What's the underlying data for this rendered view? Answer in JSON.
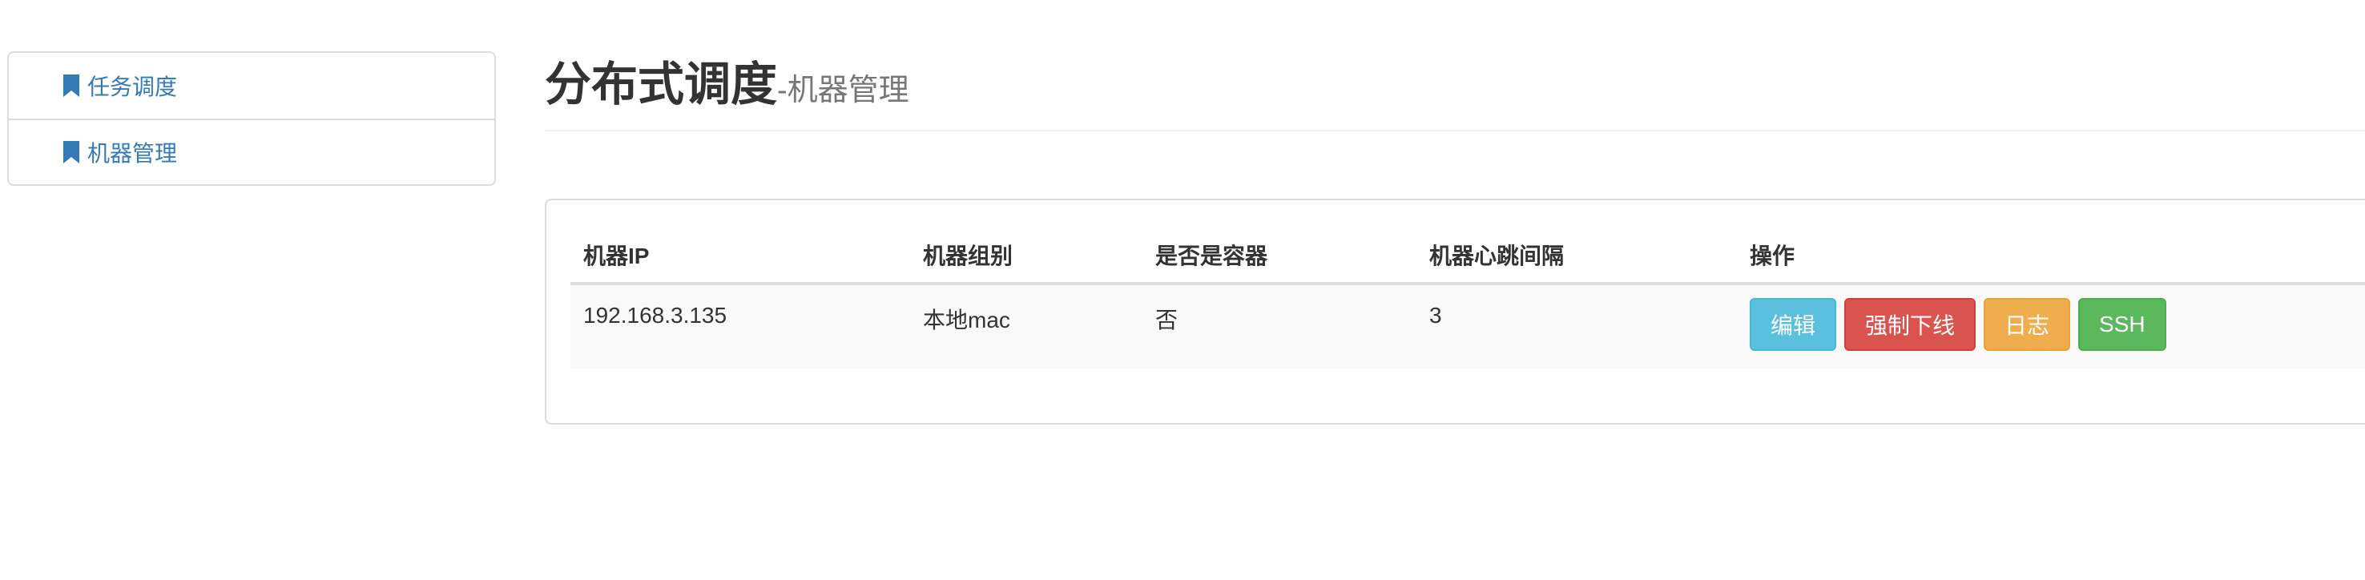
{
  "sidebar": {
    "items": [
      {
        "label": "任务调度",
        "icon": "bookmark-icon"
      },
      {
        "label": "机器管理",
        "icon": "bookmark-icon"
      }
    ]
  },
  "header": {
    "title": "分布式调度",
    "subtitle": "-机器管理"
  },
  "table": {
    "columns": [
      "机器IP",
      "机器组别",
      "是否是容器",
      "机器心跳间隔",
      "操作"
    ],
    "rows": [
      {
        "ip": "192.168.3.135",
        "group": "本地mac",
        "is_container": "否",
        "heartbeat_interval": "3",
        "actions": {
          "edit": "编辑",
          "force_offline": "强制下线",
          "log": "日志",
          "ssh": "SSH"
        }
      }
    ]
  },
  "colors": {
    "link": "#337ab7",
    "info": "#5bc0de",
    "danger": "#d9534f",
    "warning": "#f0ad4e",
    "success": "#5cb85c"
  }
}
